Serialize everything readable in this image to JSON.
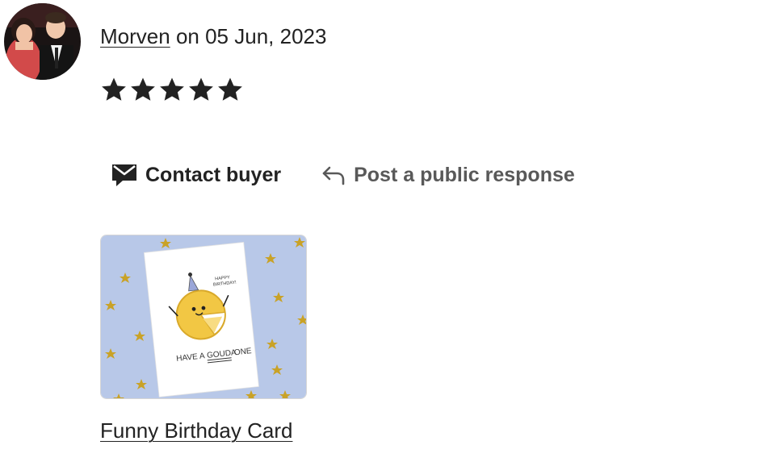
{
  "review": {
    "reviewer_name": "Morven",
    "date_prefix": "on",
    "date": "05 Jun, 2023",
    "rating": 5,
    "rating_max": 5
  },
  "actions": {
    "contact_label": "Contact buyer",
    "respond_label": "Post a public response"
  },
  "listing": {
    "title": "Funny Birthday Card",
    "card_text_top": "HAPPY BIRTHDAY!",
    "card_text_line_a": "HAVE A",
    "card_text_line_b": "GOUDA",
    "card_text_line_c": "ONE"
  },
  "icons": {
    "contact": "mail-speech-icon",
    "respond": "reply-arrow-icon",
    "star": "star-filled-icon"
  },
  "colors": {
    "text": "#222222",
    "muted": "#595959",
    "thumb_background": "#b8c8e8",
    "star_gold": "#c9a227",
    "cheese": "#f2c744"
  }
}
